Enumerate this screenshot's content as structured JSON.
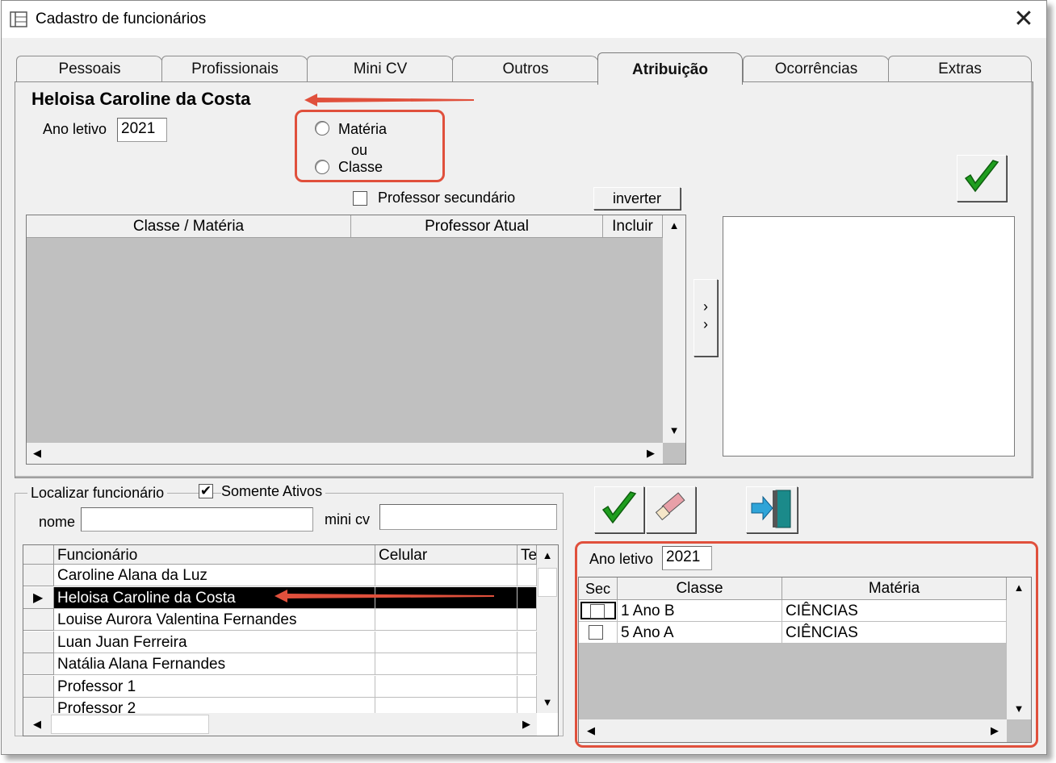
{
  "window": {
    "title": "Cadastro de funcionários"
  },
  "tabs": [
    "Pessoais",
    "Profissionais",
    "Mini CV",
    "Outros",
    "Atribuição",
    "Ocorrências",
    "Extras"
  ],
  "active_tab": "Atribuição",
  "employee_name": "Heloisa Caroline da Costa",
  "atribuicao": {
    "ano_letivo_label": "Ano letivo",
    "ano_letivo_value": "2021",
    "radio_materia": "Matéria",
    "radio_ou": "ou",
    "radio_classe": "Classe",
    "professor_secundario_label": "Professor secundário",
    "inverter_label": "inverter",
    "grid_headers": [
      "Classe / Matéria",
      "Professor Atual",
      "Incluir"
    ],
    "move_label": ">\n>"
  },
  "localizar": {
    "group_label": "Localizar funcionário",
    "somente_ativos_label": "Somente Ativos",
    "somente_ativos_checked": "✔",
    "nome_label": "nome",
    "nome_value": "",
    "minicv_label": "mini cv",
    "minicv_value": "",
    "headers": [
      "Funcionário",
      "Celular",
      "Te"
    ],
    "rows": [
      "Caroline Alana da Luz",
      "Heloisa Caroline da Costa",
      "Louise Aurora Valentina Fernandes",
      "Luan Juan Ferreira",
      "Natália Alana Fernandes",
      "Professor 1",
      "Professor 2"
    ],
    "selected_row": "Heloisa Caroline da Costa"
  },
  "resumo": {
    "ano_letivo_label": "Ano letivo",
    "ano_letivo_value": "2021",
    "headers": [
      "Sec",
      "Classe",
      "Matéria"
    ],
    "rows": [
      {
        "classe": "1 Ano B",
        "materia": "CIÊNCIAS"
      },
      {
        "classe": "5 Ano A",
        "materia": "CIÊNCIAS"
      }
    ]
  },
  "colors": {
    "highlight": "#e0503c",
    "selected_row": "#000000",
    "check_green": "#1f9e1f"
  }
}
